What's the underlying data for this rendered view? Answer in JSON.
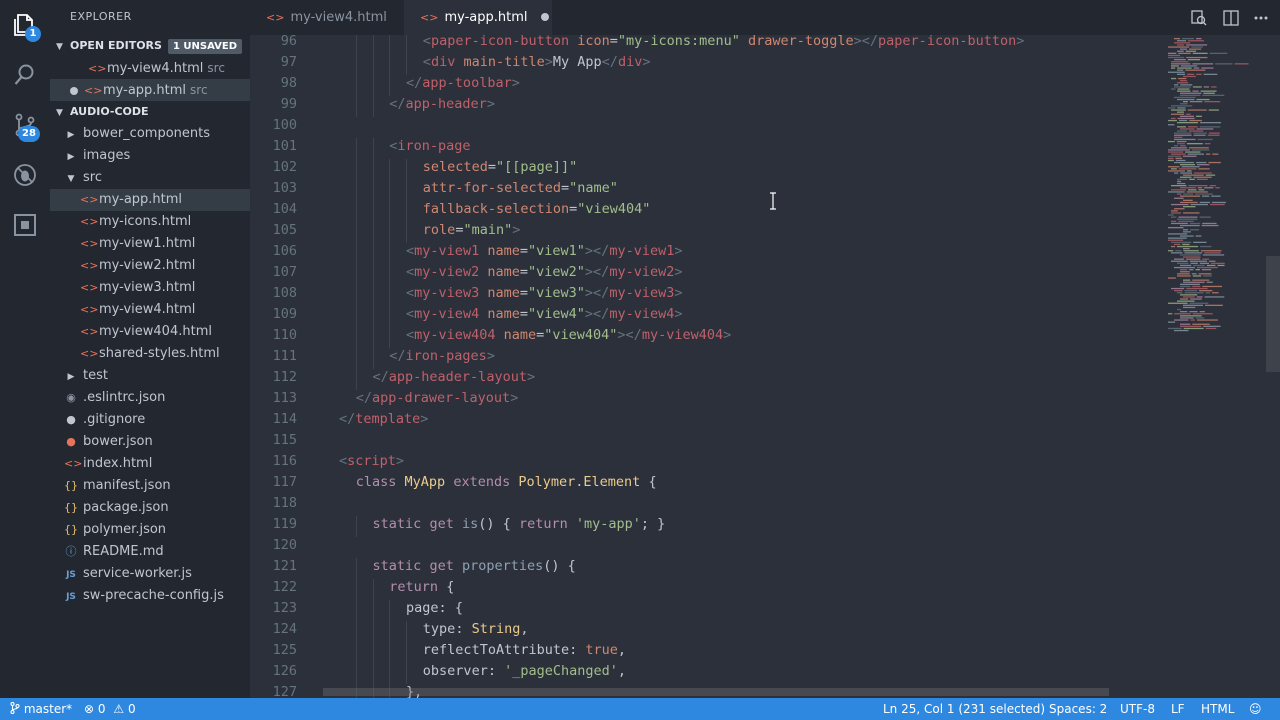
{
  "activity_bar": {
    "scm_badge": "1",
    "extensions_badge": "28"
  },
  "explorer": {
    "title": "EXPLORER",
    "open_editors": {
      "label": "OPEN EDITORS",
      "badge": "1 UNSAVED",
      "items": [
        {
          "name": "my-view4.html",
          "folder": "src"
        },
        {
          "name": "my-app.html",
          "folder": "src"
        }
      ]
    },
    "project": {
      "label": "AUDIO-CODE",
      "items": [
        {
          "name": "bower_components",
          "type": "folder"
        },
        {
          "name": "images",
          "type": "folder"
        },
        {
          "name": "src",
          "type": "folder-open"
        },
        {
          "name": "my-app.html",
          "type": "html"
        },
        {
          "name": "my-icons.html",
          "type": "html"
        },
        {
          "name": "my-view1.html",
          "type": "html"
        },
        {
          "name": "my-view2.html",
          "type": "html"
        },
        {
          "name": "my-view3.html",
          "type": "html"
        },
        {
          "name": "my-view4.html",
          "type": "html"
        },
        {
          "name": "my-view404.html",
          "type": "html"
        },
        {
          "name": "shared-styles.html",
          "type": "html"
        },
        {
          "name": "test",
          "type": "folder"
        },
        {
          "name": ".eslintrc.json",
          "type": "eslint"
        },
        {
          "name": ".gitignore",
          "type": "git"
        },
        {
          "name": "bower.json",
          "type": "bower"
        },
        {
          "name": "index.html",
          "type": "html"
        },
        {
          "name": "manifest.json",
          "type": "json"
        },
        {
          "name": "package.json",
          "type": "json"
        },
        {
          "name": "polymer.json",
          "type": "json"
        },
        {
          "name": "README.md",
          "type": "md"
        },
        {
          "name": "service-worker.js",
          "type": "js"
        },
        {
          "name": "sw-precache-config.js",
          "type": "js"
        }
      ]
    }
  },
  "tabs": [
    {
      "label": "my-view4.html",
      "active": false
    },
    {
      "label": "my-app.html",
      "active": true,
      "dirty": true
    }
  ],
  "editor": {
    "lines": [
      {
        "n": "96",
        "code": "<paper-icon-button icon=\"my-icons:menu\" drawer-toggle></paper-icon-button>"
      },
      {
        "n": "97",
        "code": "<div main-title>My App</div>"
      },
      {
        "n": "98",
        "code": "</app-toolbar>"
      },
      {
        "n": "99",
        "code": "</app-header>"
      },
      {
        "n": "100",
        "code": ""
      },
      {
        "n": "101",
        "code": "<iron-pages"
      },
      {
        "n": "102",
        "code": "selected=\"[[page]]\""
      },
      {
        "n": "103",
        "code": "attr-for-selected=\"name\""
      },
      {
        "n": "104",
        "code": "fallback-selection=\"view404\""
      },
      {
        "n": "105",
        "code": "role=\"main\">"
      },
      {
        "n": "106",
        "code": "<my-view1 name=\"view1\"></my-view1>"
      },
      {
        "n": "107",
        "code": "<my-view2 name=\"view2\"></my-view2>"
      },
      {
        "n": "108",
        "code": "<my-view3 name=\"view3\"></my-view3>"
      },
      {
        "n": "109",
        "code": "<my-view4 name=\"view4\"></my-view4>"
      },
      {
        "n": "110",
        "code": "<my-view404 name=\"view404\"></my-view404>"
      },
      {
        "n": "111",
        "code": "</iron-pages>"
      },
      {
        "n": "112",
        "code": "</app-header-layout>"
      },
      {
        "n": "113",
        "code": "</app-drawer-layout>"
      },
      {
        "n": "114",
        "code": "</template>"
      },
      {
        "n": "115",
        "code": ""
      },
      {
        "n": "116",
        "code": "<script>"
      },
      {
        "n": "117",
        "code": "class MyApp extends Polymer.Element {"
      },
      {
        "n": "118",
        "code": ""
      },
      {
        "n": "119",
        "code": "static get is() { return 'my-app'; }"
      },
      {
        "n": "120",
        "code": ""
      },
      {
        "n": "121",
        "code": "static get properties() {"
      },
      {
        "n": "122",
        "code": "return {"
      },
      {
        "n": "123",
        "code": "page: {"
      },
      {
        "n": "124",
        "code": "type: String,"
      },
      {
        "n": "125",
        "code": "reflectToAttribute: true,"
      },
      {
        "n": "126",
        "code": "observer: '_pageChanged',"
      },
      {
        "n": "127",
        "code": "},"
      }
    ]
  },
  "status_bar": {
    "branch": "master*",
    "errors": "0",
    "warnings": "0",
    "cursor": "Ln 25, Col 1 (231 selected)",
    "spaces": "Spaces: 2",
    "encoding": "UTF-8",
    "eol": "LF",
    "language": "HTML"
  },
  "colors": {
    "status_bar": "#2f88e0",
    "editor_bg": "#2b303b",
    "sidebar_bg": "#232830"
  }
}
